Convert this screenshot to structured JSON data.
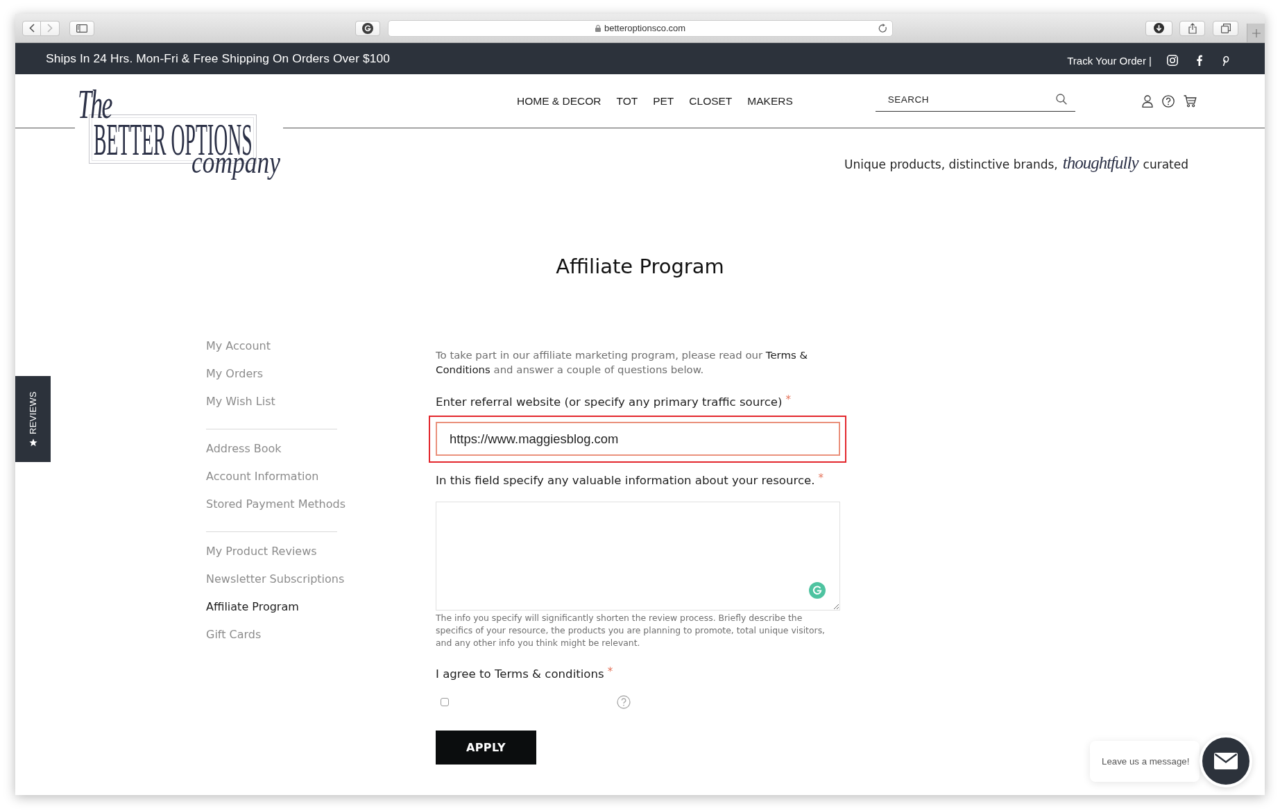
{
  "browser": {
    "nav_buttons": [
      {
        "kind": "back",
        "disabled": false
      },
      {
        "kind": "forward",
        "disabled": true
      }
    ],
    "url": "betteroptionsco.com"
  },
  "announcement_bar": {
    "text": "Ships In 24 Hrs. Mon-Fri & Free Shipping On Orders Over $100",
    "track_order_link": "Track Your Order |"
  },
  "logo": {
    "top": "The",
    "wordmark": "BETTER OPTIONS",
    "bottom": "company"
  },
  "nav": [
    "HOME & DECOR",
    "TOT",
    "PET",
    "CLOSET",
    "MAKERS"
  ],
  "search": {
    "placeholder": "SEARCH"
  },
  "tagline": {
    "before": "Unique products, distinctive brands,",
    "script": "thoughtfully",
    "after": "curated"
  },
  "page_title": "Affiliate Program",
  "sidebar": {
    "groups": [
      {
        "items": [
          {
            "label": "My Account",
            "selected": false
          },
          {
            "label": "My Orders",
            "selected": false
          },
          {
            "label": "My Wish List",
            "selected": false
          }
        ]
      },
      {
        "items": [
          {
            "label": "Address Book",
            "selected": false
          },
          {
            "label": "Account Information",
            "selected": false
          },
          {
            "label": "Stored Payment Methods",
            "selected": false
          }
        ]
      },
      {
        "items": [
          {
            "label": "My Product Reviews",
            "selected": false
          },
          {
            "label": "Newsletter Subscriptions",
            "selected": false
          },
          {
            "label": "Affiliate Program",
            "selected": true
          },
          {
            "label": "Gift Cards",
            "selected": false
          }
        ]
      }
    ]
  },
  "form": {
    "intro": "To take part in our affiliate marketing program, please read our **Terms & Conditions** and answer a couple of questions below.",
    "fields": [
      {
        "kind": "text",
        "label": "Enter referral website (or specify any primary traffic source)",
        "required_mark": "*",
        "value": "https://www.maggiesblog.com",
        "focused": true,
        "highlighted": true
      },
      {
        "kind": "textarea",
        "label": "In this field specify any valuable information about your resource.",
        "required_mark": "*",
        "focused": false,
        "highlighted": false,
        "note": "The info you specify will significantly shorten the review process. Briefly describe the specifics of your resource, the products you are planning to promote, total unique visitors, and any other info you think might be relevant."
      },
      {
        "kind": "checkbox",
        "label": "I agree to Terms & conditions",
        "required_mark": "*",
        "checked": false,
        "focused": false,
        "highlighted": false
      }
    ],
    "submit_button": "APPLY"
  },
  "reviews_tab": {
    "label": "REVIEWS"
  },
  "chat_widget": {
    "prompt": "Leave us a message!"
  }
}
